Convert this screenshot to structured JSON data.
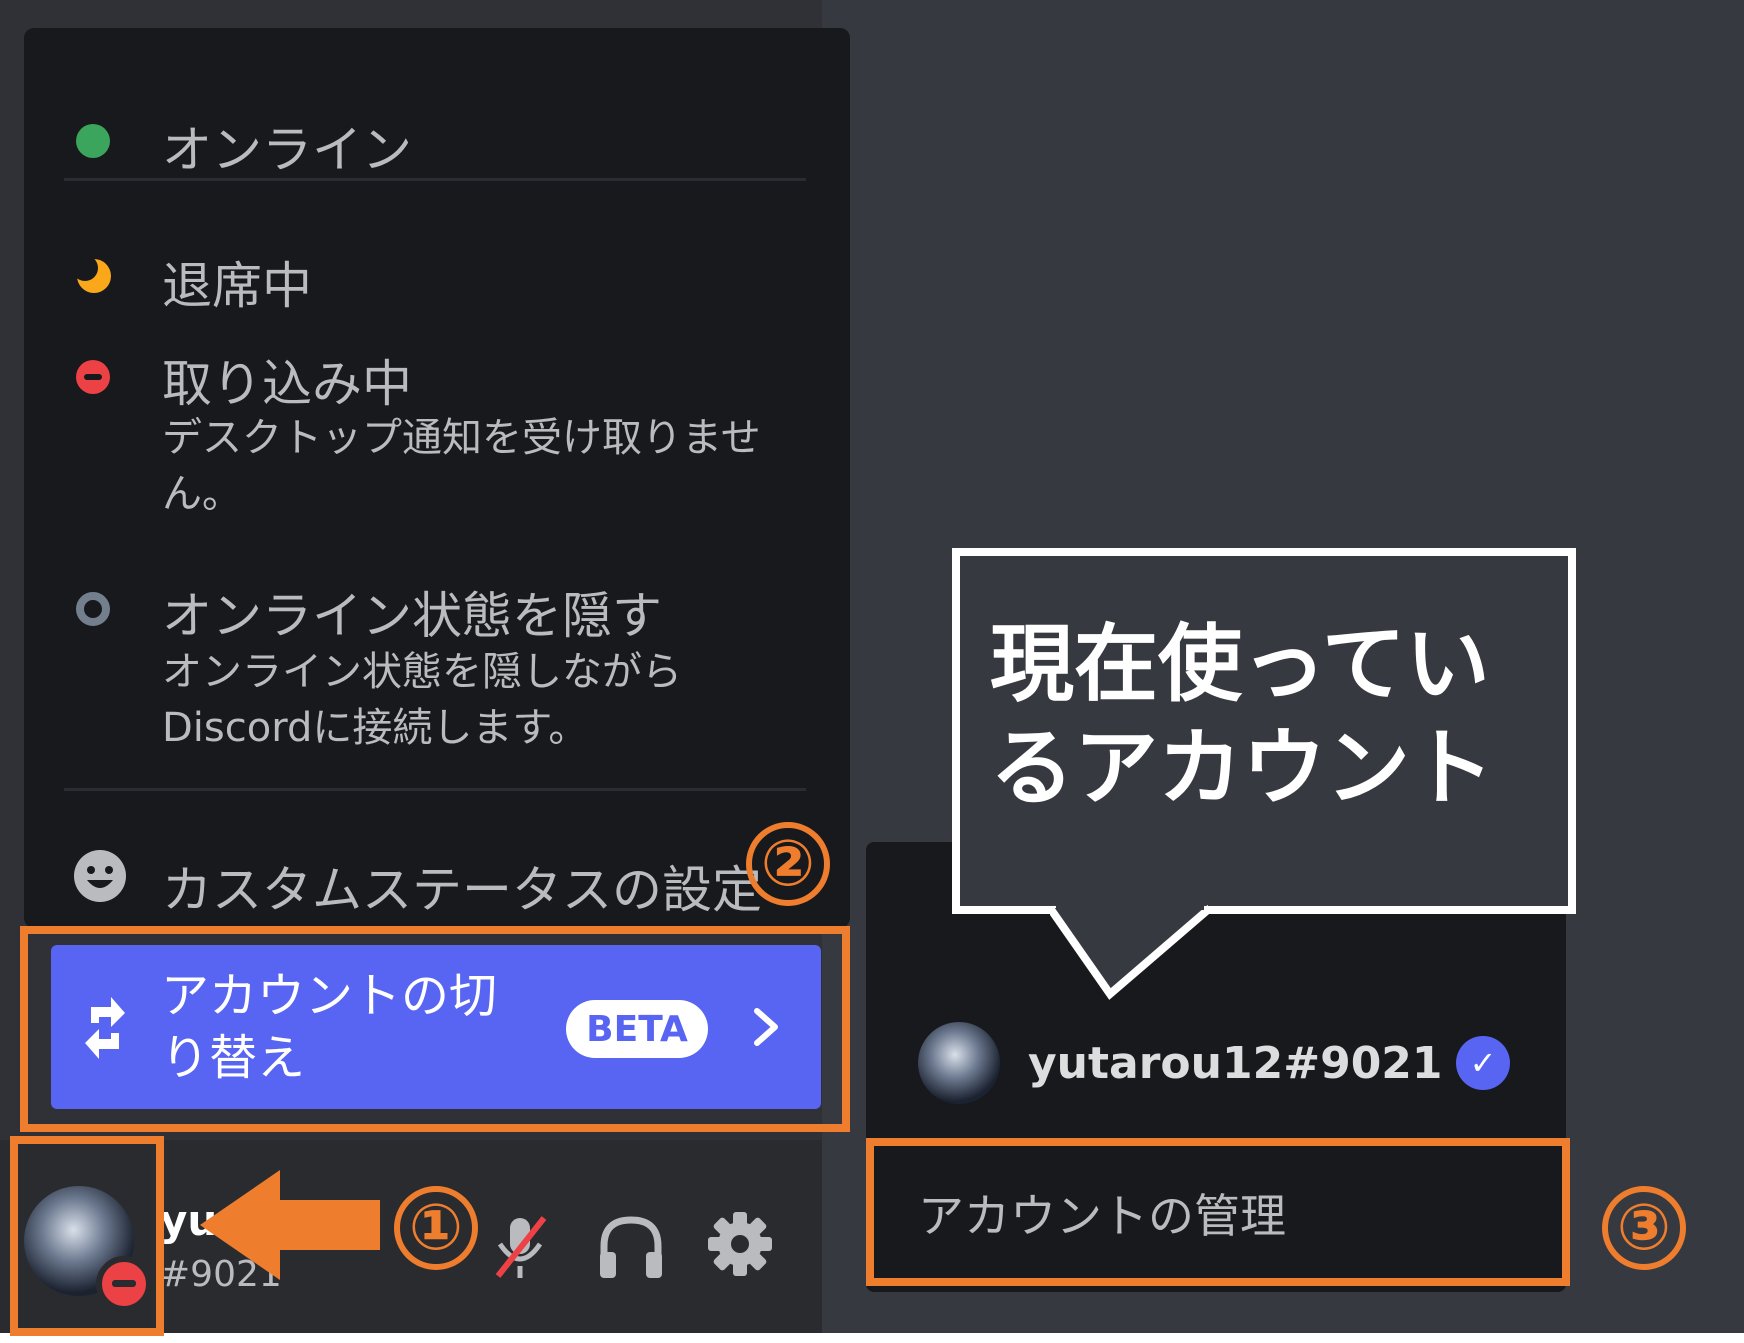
{
  "status_menu": {
    "online": "オンライン",
    "idle": "退席中",
    "dnd": {
      "label": "取り込み中",
      "description": "デスクトップ通知を受け取りません。"
    },
    "invisible": {
      "label": "オンライン状態を隠す",
      "description": "オンライン状態を隠しながらDiscordに接続します。"
    },
    "custom_status": "カスタムステータスの設定",
    "switch_accounts": {
      "label": "アカウントの切り替え",
      "badge": "BETA"
    }
  },
  "user_panel": {
    "name": "yu",
    "tag": "#9021"
  },
  "account_popout": {
    "account": "yutarou12#9021",
    "manage": "アカウントの管理"
  },
  "annotations": {
    "callout": "現在使っているアカウント",
    "step1": "①",
    "step2": "②",
    "step3": "③"
  },
  "colors": {
    "online": "#3ba55d",
    "idle": "#faa81a",
    "dnd": "#ed4245",
    "invisible": "#747f8d",
    "brand": "#5865f2",
    "highlight": "#ef7d2e"
  }
}
